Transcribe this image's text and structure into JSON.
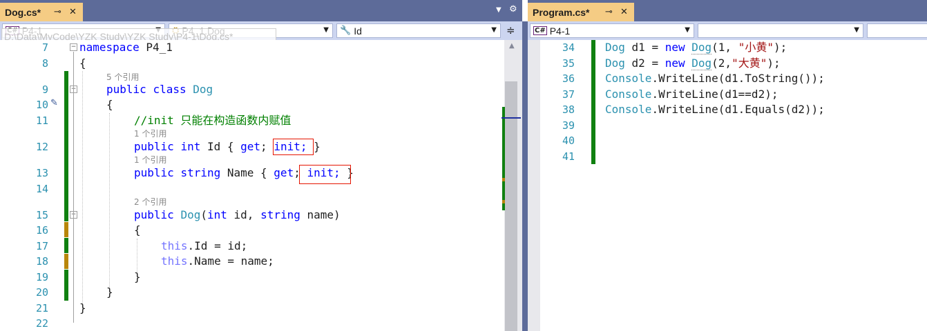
{
  "left_pane": {
    "tab": {
      "title": "Dog.cs*",
      "pin_icon": "pin-icon",
      "close_icon": "close-icon"
    },
    "nav": {
      "project": "P4-1",
      "class": "P4_1.Dog",
      "member": "Id",
      "tooltip": "D:\\Data\\MyCode\\YZK Study\\YZK Study\\P4-1\\Dog.cs*"
    },
    "code_lines": [
      {
        "num": "7"
      },
      {
        "num": "8"
      },
      {
        "num": "9",
        "refs": "5 个引用"
      },
      {
        "num": "10"
      },
      {
        "num": "11"
      },
      {
        "num": "12",
        "refs": "1 个引用"
      },
      {
        "num": "13",
        "refs": "1 个引用"
      },
      {
        "num": "14"
      },
      {
        "num": "15",
        "refs": "2 个引用"
      },
      {
        "num": "16"
      },
      {
        "num": "17"
      },
      {
        "num": "18"
      },
      {
        "num": "19"
      },
      {
        "num": "20"
      },
      {
        "num": "21"
      },
      {
        "num": "22"
      }
    ],
    "code_text": {
      "l7_kw": "namespace",
      "l7_rest": " P4_1",
      "l8": "{",
      "l9_kw1": "public",
      "l9_kw2": "class",
      "l9_type": "Dog",
      "l10": "{",
      "l11_comment": "//init 只能在构造函数内赋值",
      "l12_kw1": "public",
      "l12_kw2": "int",
      "l12_name": " Id { ",
      "l12_get": "get",
      "l12_semi": ";",
      "l12_init": " init;",
      "l12_end": " }",
      "l13_kw1": "public",
      "l13_kw2": "string",
      "l13_name": " Name { ",
      "l13_get": "get",
      "l13_semi": ";",
      "l13_init": " init;",
      "l13_end": " }",
      "l15_kw1": "public",
      "l15_type": "Dog",
      "l15_p1": "(",
      "l15_kw2": "int",
      "l15_p2": " id, ",
      "l15_kw3": "string",
      "l15_p3": " name)",
      "l16": "{",
      "l17_this": "this",
      "l17_rest": ".Id = id;",
      "l18_this": "this",
      "l18_rest": ".Name = name;",
      "l19": "}",
      "l20": "}",
      "l21": "}"
    }
  },
  "right_pane": {
    "tab": {
      "title": "Program.cs*",
      "pin_icon": "pin-icon",
      "close_icon": "close-icon"
    },
    "nav": {
      "project": "P4-1",
      "class": "",
      "member": ""
    },
    "code_lines": [
      {
        "num": "34"
      },
      {
        "num": "35"
      },
      {
        "num": "36"
      },
      {
        "num": "37"
      },
      {
        "num": "38"
      },
      {
        "num": "39"
      },
      {
        "num": "40"
      },
      {
        "num": "41"
      }
    ],
    "code_text": {
      "l34_t": "Dog",
      "l34_a": " d1 = ",
      "l34_kw": "new",
      "l34_sp": " ",
      "l34_t2": "Dog",
      "l34_b": "(1, ",
      "l34_s": "\"小黄\"",
      "l34_c": ");",
      "l35_t": "Dog",
      "l35_a": " d2 = ",
      "l35_kw": "new",
      "l35_sp": " ",
      "l35_t2": "Dog",
      "l35_b": "(2,",
      "l35_s": "\"大黄\"",
      "l35_c": ");",
      "l36_t": "Console",
      "l36_a": ".WriteLine(d1.ToString());",
      "l37_t": "Console",
      "l37_a": ".WriteLine(d1==d2);",
      "l38_t": "Console",
      "l38_a": ".WriteLine(d1.Equals(d2));"
    }
  },
  "colors": {
    "tab_active": "#f5cc84",
    "chrome": "#5d6b99",
    "navbar": "#ccd5f0",
    "line_number": "#2b91af",
    "keyword": "#0000ff",
    "type": "#2b91af",
    "comment": "#008000",
    "string": "#a31515",
    "change_saved": "#108010",
    "change_unsaved": "#b8860b",
    "highlight_box": "#e51400"
  }
}
